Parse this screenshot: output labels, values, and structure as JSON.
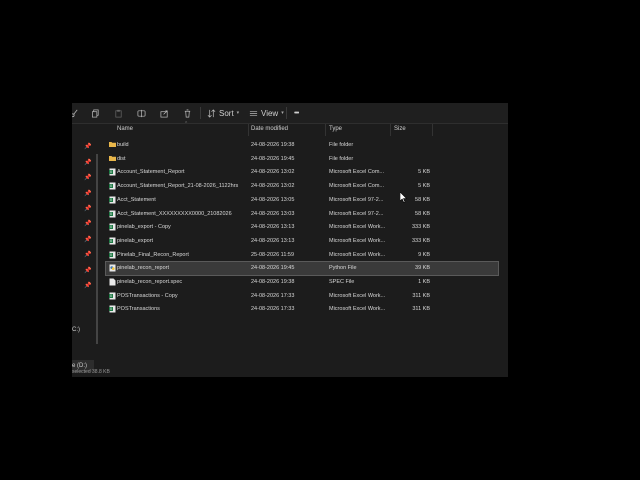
{
  "toolbar": {
    "sort_label": "Sort",
    "view_label": "View",
    "more_label": "•••"
  },
  "nav": {
    "fragments": [
      "C:)",
      "e (D:)"
    ]
  },
  "columns": {
    "name": "Name",
    "date_modified": "Date modified",
    "type": "Type",
    "size": "Size"
  },
  "files": [
    {
      "name": "build",
      "date": "24-08-2026 19:38",
      "type": "File folder",
      "size": "",
      "icon": "folder"
    },
    {
      "name": "dist",
      "date": "24-08-2026 19:45",
      "type": "File folder",
      "size": "",
      "icon": "folder"
    },
    {
      "name": "Account_Statement_Report",
      "date": "24-08-2026 13:02",
      "type": "Microsoft Excel Com...",
      "size": "5 KB",
      "icon": "excel"
    },
    {
      "name": "Account_Statement_Report_21-08-2026_1122hrs",
      "date": "24-08-2026 13:02",
      "type": "Microsoft Excel Com...",
      "size": "5 KB",
      "icon": "excel"
    },
    {
      "name": "Acct_Statement",
      "date": "24-08-2026 13:05",
      "type": "Microsoft Excel 97-2...",
      "size": "58 KB",
      "icon": "excel"
    },
    {
      "name": "Acct_Statement_XXXXXXXXX0000_21082026",
      "date": "24-08-2026 13:03",
      "type": "Microsoft Excel 97-2...",
      "size": "58 KB",
      "icon": "excel"
    },
    {
      "name": "pinelab_export - Copy",
      "date": "24-08-2026 13:13",
      "type": "Microsoft Excel Work...",
      "size": "333 KB",
      "icon": "excel"
    },
    {
      "name": "pinelab_export",
      "date": "24-08-2026 13:13",
      "type": "Microsoft Excel Work...",
      "size": "333 KB",
      "icon": "excel"
    },
    {
      "name": "Pinelab_Final_Recon_Report",
      "date": "25-08-2026 11:59",
      "type": "Microsoft Excel Work...",
      "size": "9 KB",
      "icon": "excel"
    },
    {
      "name": "pinelab_recon_report",
      "date": "24-08-2026 19:45",
      "type": "Python File",
      "size": "39 KB",
      "icon": "python"
    },
    {
      "name": "pinelab_recon_report.spec",
      "date": "24-08-2026 19:38",
      "type": "SPEC File",
      "size": "1 KB",
      "icon": "file"
    },
    {
      "name": "POSTransactions - Copy",
      "date": "24-08-2026 17:33",
      "type": "Microsoft Excel Work...",
      "size": "311 KB",
      "icon": "excel"
    },
    {
      "name": "POSTransactions",
      "date": "24-08-2026 17:33",
      "type": "Microsoft Excel Work...",
      "size": "311 KB",
      "icon": "excel"
    }
  ],
  "selected_file": "pinelab_recon_report",
  "status": {
    "text": "selected  38.8 KB"
  },
  "colors": {
    "window_bg": "#1c1c1c",
    "folder": "#e8b64a",
    "excel": "#1f7a45",
    "selection": "#3a3a3a"
  }
}
